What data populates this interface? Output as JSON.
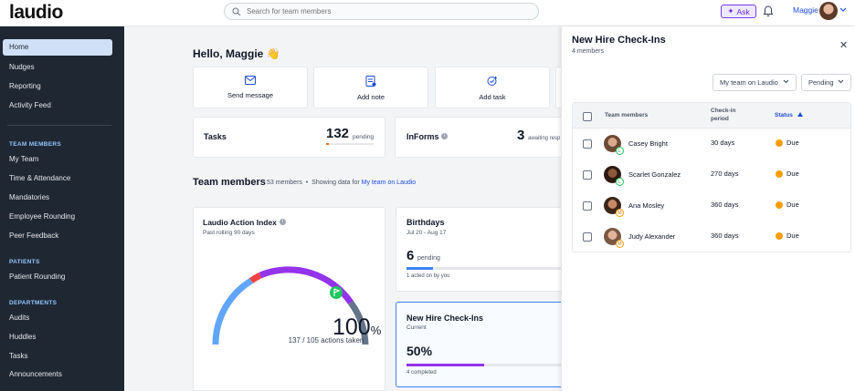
{
  "app": {
    "logo": "laudio"
  },
  "topbar": {
    "search_placeholder": "Search for team members",
    "ask_label": "Ask",
    "user_name": "Maggie"
  },
  "sidebar": {
    "home": "Home",
    "nudges": "Nudges",
    "reporting": "Reporting",
    "activity_feed": "Activity Feed",
    "team_members_head": "TEAM MEMBERS",
    "my_team": "My Team",
    "time_attendance": "Time & Attendance",
    "mandatories": "Mandatories",
    "employee_rounding": "Employee Rounding",
    "peer_feedback": "Peer Feedback",
    "patients_head": "PATIENTS",
    "patient_rounding": "Patient Rounding",
    "departments_head": "DEPARTMENTS",
    "audits": "Audits",
    "huddles": "Huddles",
    "tasks": "Tasks",
    "announcements": "Announcements"
  },
  "main": {
    "greeting": "Hello, Maggie 👋",
    "actions": {
      "send_message": "Send message",
      "add_note": "Add note",
      "add_task": "Add task"
    },
    "tasks": {
      "title": "Tasks",
      "count": "132",
      "label": "pending",
      "progress": 0.06
    },
    "informs": {
      "title": "InForms",
      "count": "3",
      "label": "awaiting resp"
    },
    "team_section": {
      "title": "Team members",
      "count_text": "53 members",
      "showing_text": "Showing data for",
      "team_link": "My team on Laudio"
    },
    "action_index": {
      "title": "Laudio Action Index",
      "subtitle": "Past rolling 90 days",
      "value": "100",
      "unit": "%",
      "detail": "137 / 105 actions taken"
    },
    "birthdays": {
      "title": "Birthdays",
      "range": "Jul 20 - Aug 17",
      "count": "6",
      "label": "pending",
      "acted": "1 acted on by you",
      "progress": 0.17
    },
    "new_hire": {
      "title": "New Hire Check-Ins",
      "subtitle": "Current",
      "value": "50%",
      "completed": "4 completed",
      "progress": 0.5
    }
  },
  "panel": {
    "title": "New Hire Check-Ins",
    "subtitle": "4 members",
    "filter_team": "My team on Laudio",
    "filter_status": "Pending",
    "columns": {
      "members": "Team members",
      "period_line1": "Check-in",
      "period_line2": "period",
      "status": "Status"
    },
    "rows": [
      {
        "name": "Casey Bright",
        "badge": "L",
        "period": "30 days",
        "status": "Due"
      },
      {
        "name": "Scarlet Gonzalez",
        "badge": "L",
        "period": "270 days",
        "status": "Due"
      },
      {
        "name": "Ana Mosley",
        "badge": "M",
        "period": "360 days",
        "status": "Due"
      },
      {
        "name": "Judy Alexander",
        "badge": "M",
        "period": "360 days",
        "status": "Due"
      }
    ]
  },
  "colors": {
    "accent": "#1d4ed8",
    "due": "#f59e0b",
    "purple": "#9333ea",
    "sidebar": "#1f2733"
  }
}
